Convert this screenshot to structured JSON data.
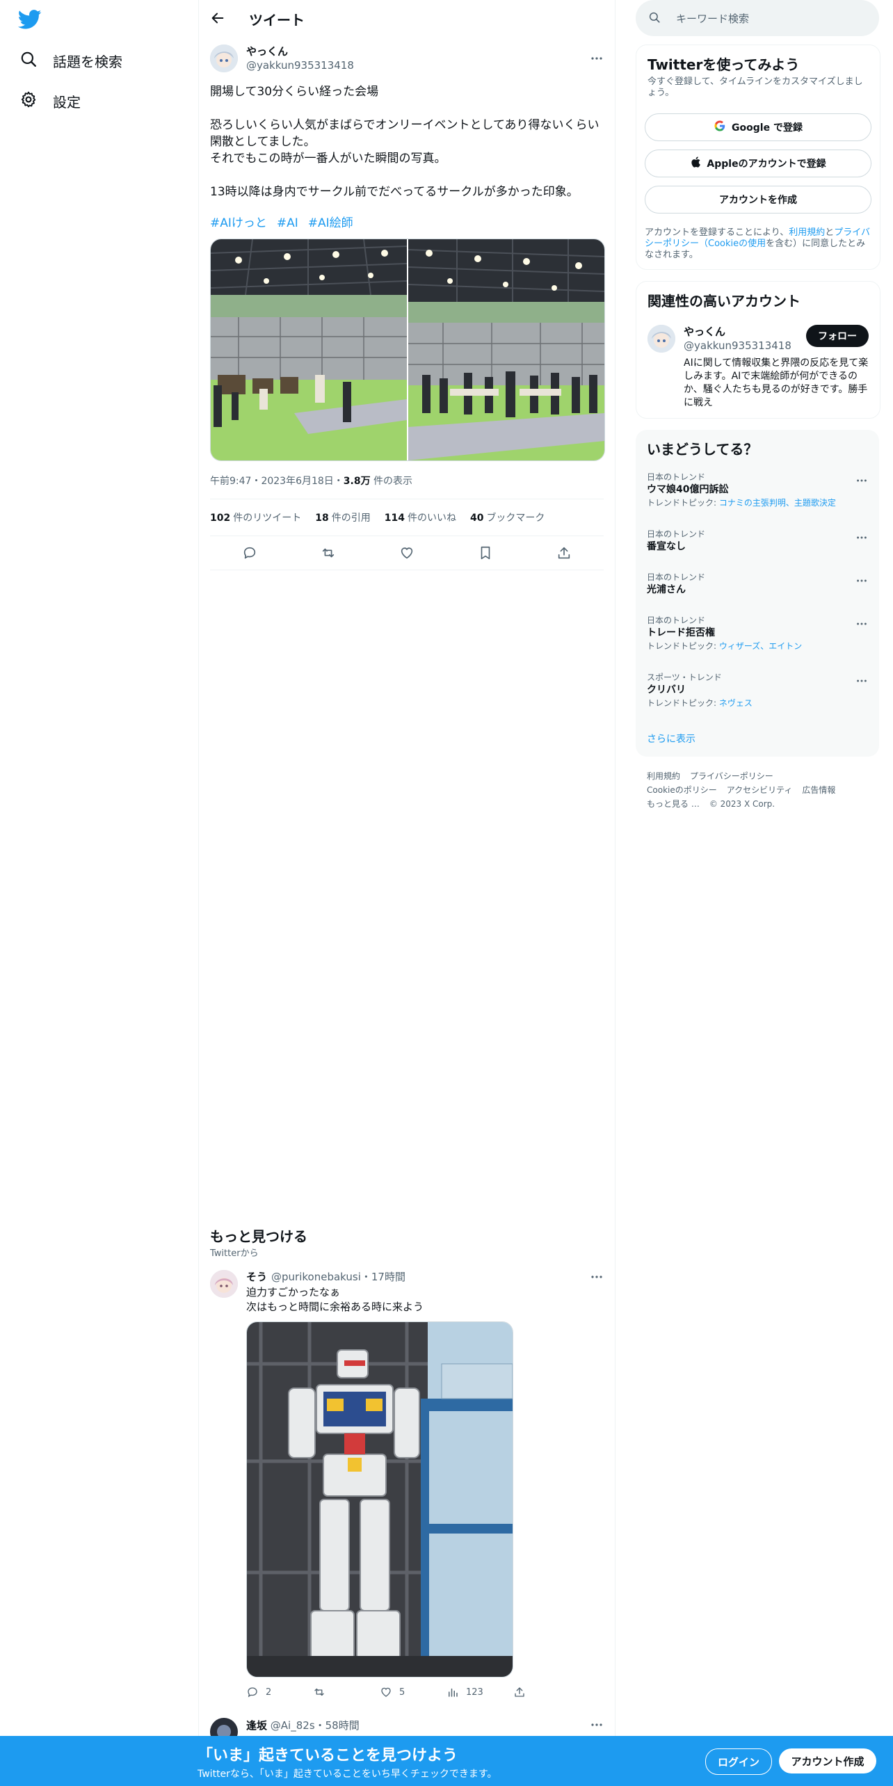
{
  "nav": {
    "items": [
      {
        "label": "話題を検索",
        "icon": "search-icon"
      },
      {
        "label": "設定",
        "icon": "gear-icon"
      }
    ],
    "logo": "twitter-bird-icon"
  },
  "header": {
    "title": "ツイート"
  },
  "tweet": {
    "name": "やっくん",
    "handle": "@yakkun935313418",
    "text": "開場して30分くらい経った会場\n\n恐ろしいくらい人気がまばらでオンリーイベントとしてあり得ないくらい閑散としてました。\nそれでもこの時が一番人がいた瞬間の写真。\n\n13時以降は身内でサークル前でだべってるサークルが多かった印象。",
    "hashtags": [
      "#AIけっと",
      "#AI",
      "#AI絵師"
    ],
    "time": "午前9:47・2023年6月18日・",
    "views_count": "3.8万",
    "views_label": " 件の表示",
    "stats": [
      {
        "count": "102",
        "label": "件のリツイート"
      },
      {
        "count": "18",
        "label": "件の引用"
      },
      {
        "count": "114",
        "label": "件のいいね"
      },
      {
        "count": "40",
        "label": "ブックマーク"
      }
    ]
  },
  "discover": {
    "title": "もっと見つける",
    "subtitle": "Twitterから"
  },
  "reply": {
    "name": "そう",
    "handle": "@purikonebakusi",
    "time": "・17時間",
    "text": "迫力すごかったなぁ\n次はもっと時間に余裕ある時に来よう",
    "replies": "2",
    "likes": "5",
    "views": "123"
  },
  "next_tweet": {
    "name": "逢坂",
    "handle": "@Ai_82s",
    "time": "・58時間"
  },
  "search": {
    "placeholder": "キーワード検索"
  },
  "signup_card": {
    "title": "Twitterを使ってみよう",
    "subtitle": "今すぐ登録して、タイムラインをカスタマイズしましょう。",
    "google": "Google で登録",
    "apple": "Appleのアカウントで登録",
    "create": "アカウントを作成",
    "legal_prefix": "アカウントを登録することにより、",
    "terms": "利用規約",
    "and": "と",
    "privacy": "プライバシーポリシー",
    "cookie_open": "（",
    "cookie": "Cookieの使用",
    "legal_suffix": "を含む）に同意したとみなされます。"
  },
  "related": {
    "title": "関連性の高いアカウント",
    "name": "やっくん",
    "handle": "@yakkun935313418",
    "follow": "フォロー",
    "bio": "AIに関して情報収集と界隈の反応を見て楽しみます。AIで末端絵師が何ができるのか、騒ぐ人たちも見るのが好きです。勝手に戦え"
  },
  "trends": {
    "title": "いまどうしてる？",
    "items": [
      {
        "context": "日本のトレンド",
        "name": "ウマ娘40億円訴訟",
        "topic_label": "トレンドトピック: ",
        "topic": "コナミの主張判明、主題歌決定"
      },
      {
        "context": "日本のトレンド",
        "name": "番宣なし",
        "topic_label": "",
        "topic": ""
      },
      {
        "context": "日本のトレンド",
        "name": "光浦さん",
        "topic_label": "",
        "topic": ""
      },
      {
        "context": "日本のトレンド",
        "name": "トレード拒否権",
        "topic_label": "トレンドトピック: ",
        "topic": "ウィザーズ、エイトン"
      },
      {
        "context": "スポーツ・トレンド",
        "name": "クリバリ",
        "topic_label": "トレンドトピック: ",
        "topic": "ネヴェス"
      }
    ],
    "show_more": "さらに表示"
  },
  "footer": {
    "links": [
      "利用規約",
      "プライバシーポリシー",
      "Cookieのポリシー",
      "アクセシビリティ",
      "広告情報",
      "もっと見る …",
      "© 2023 X Corp."
    ]
  },
  "bottom_bar": {
    "title": "「いま」起きていることを見つけよう",
    "subtitle": "Twitterなら、「いま」起きていることをいち早くチェックできます。",
    "login": "ログイン",
    "signup": "アカウント作成"
  },
  "colors": {
    "accent": "#1d9bf0",
    "text": "#0f1419",
    "secondary": "#536471"
  }
}
